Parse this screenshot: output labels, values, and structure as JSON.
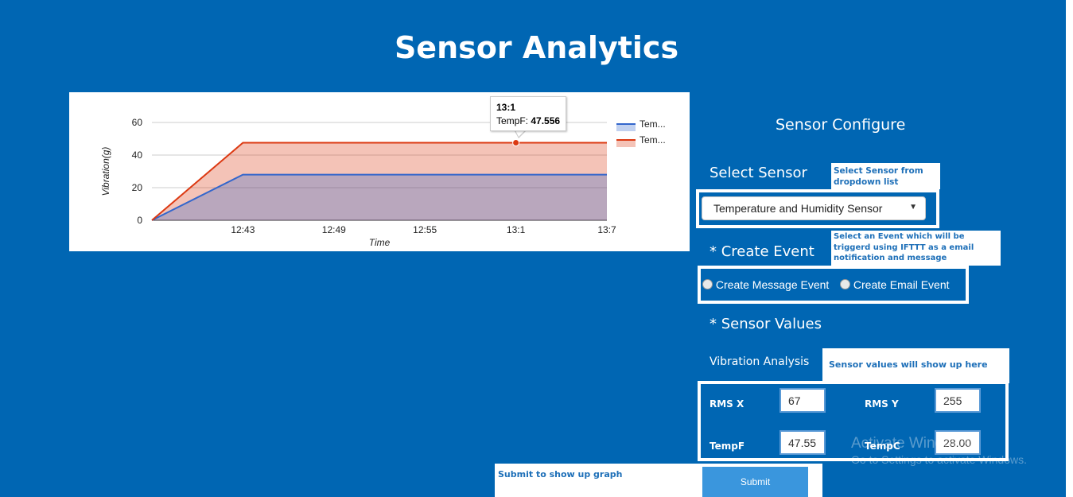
{
  "page": {
    "title": "Sensor Analytics"
  },
  "chart": {
    "tooltip": {
      "title": "13:1",
      "series_label": "TempF: ",
      "value": "47.556"
    }
  },
  "chart_data": {
    "type": "area",
    "x": [
      "",
      "12:43",
      "12:49",
      "12:55",
      "13:1",
      "13:7"
    ],
    "ylabel": "Vibration(g)",
    "xlabel": "Time",
    "ylim": [
      0,
      60
    ],
    "yticks": [
      0,
      20,
      40,
      60
    ],
    "grid": true,
    "legend_position": "top-right",
    "series": [
      {
        "name": "Tem...",
        "color": "#3366cc",
        "values": [
          0,
          28,
          28,
          28,
          28,
          28
        ]
      },
      {
        "name": "Tem...",
        "color": "#dc3912",
        "values": [
          0,
          47.556,
          47.556,
          47.556,
          47.556,
          47.556
        ]
      }
    ]
  },
  "config": {
    "heading": "Sensor Configure",
    "select_sensor": {
      "label": "Select Sensor",
      "note": "Select Sensor from dropdown list",
      "selected": "Temperature and Humidity Sensor"
    },
    "create_event": {
      "label": "* Create Event",
      "note": "Select an Event which will be triggerd using IFTTT as a email notification and message",
      "options": [
        "Create Message Event",
        "Create Email Event"
      ]
    },
    "sensor_values": {
      "label": "* Sensor Values",
      "analysis_label": "Vibration Analysis",
      "note": "Sensor values will show up here",
      "fields": [
        {
          "label": "RMS X",
          "value": "67"
        },
        {
          "label": "RMS Y",
          "value": "255"
        },
        {
          "label": "TempF",
          "value": "47.55"
        },
        {
          "label": "TempC",
          "value": "28.00"
        }
      ]
    },
    "submit": {
      "note": "Submit to show up graph",
      "label": "Submit"
    }
  },
  "watermark": {
    "line1": "Activate Windows",
    "line2": "Go to Settings to activate Windows."
  },
  "colors": {
    "background": "#0066b3",
    "series1": "#3366cc",
    "series2": "#dc3912"
  }
}
